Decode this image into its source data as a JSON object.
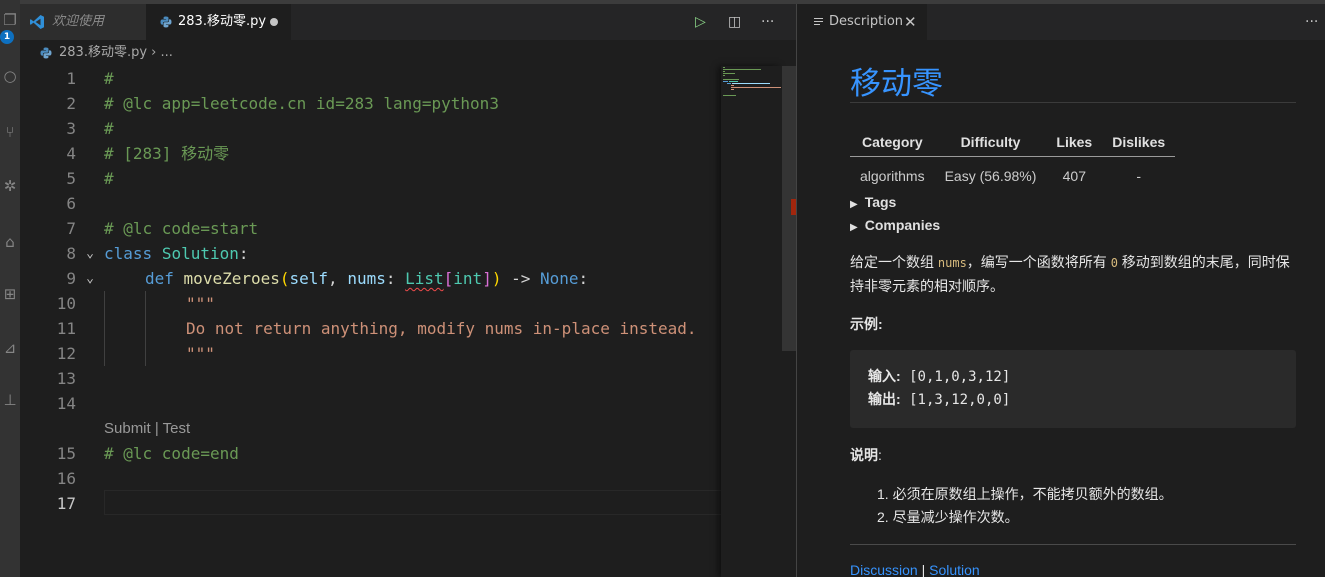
{
  "editor": {
    "tabs": [
      {
        "label": "欢迎使用"
      },
      {
        "label": "283.移动零.py",
        "dirty": true
      }
    ],
    "breadcrumb": {
      "file": "283.移动零.py",
      "more": "...",
      "sep": "›"
    },
    "codelens": "Submit | Test",
    "current_line": 17,
    "line_numbers": [
      "1",
      "2",
      "3",
      "4",
      "5",
      "6",
      "7",
      "8",
      "9",
      "10",
      "11",
      "12",
      "13",
      "14",
      "15",
      "16",
      "17"
    ],
    "code": {
      "l1": "#",
      "l2": "# @lc app=leetcode.cn id=283 lang=python3",
      "l3": "#",
      "l4": "# [283] 移动零",
      "l5": "#",
      "l7": "# @lc code=start",
      "l8_kw": "class",
      "l8_cls": "Solution",
      "l8_colon": ":",
      "l9_kw": "def",
      "l9_fn": "moveZeroes",
      "l9_paren_open": "(",
      "l9_self": "self",
      "l9_comma": ", ",
      "l9_nums": "nums",
      "l9_colon": ": ",
      "l9_list": "List",
      "l9_br_open": "[",
      "l9_int": "int",
      "l9_br_close": "]",
      "l9_paren_close": ")",
      "l9_arrow": " -> ",
      "l9_none": "None",
      "l9_end": ":",
      "l10": "\"\"\"",
      "l11": "Do not return anything, modify nums in-place instead.",
      "l12": "\"\"\"",
      "l15": "# @lc code=end"
    },
    "activity_badge": "1"
  },
  "description": {
    "tab_label": "Description",
    "title": "移动零",
    "meta_headers": [
      "Category",
      "Difficulty",
      "Likes",
      "Dislikes"
    ],
    "meta_values": [
      "algorithms",
      "Easy (56.98%)",
      "407",
      "-"
    ],
    "tags_label": "Tags",
    "companies_label": "Companies",
    "para1_a": "给定一个数组 ",
    "para1_code1": "nums",
    "para1_b": "，编写一个函数将所有 ",
    "para1_code2": "0",
    "para1_c": " 移动到数组的末尾，同时保持非零元素的相对顺序。",
    "example_heading": "示例:",
    "input_label": "输入:",
    "input_value": " [0,1,0,3,12]",
    "output_label": "输出:",
    "output_value": " [1,3,12,0,0]",
    "notes_heading": "说明",
    "notes_colon": ":",
    "notes": [
      "1. 必须在原数组上操作，不能拷贝额外的数组。",
      "2. 尽量减少操作次数。"
    ],
    "link_discussion": "Discussion",
    "link_sep": " | ",
    "link_solution": "Solution"
  }
}
